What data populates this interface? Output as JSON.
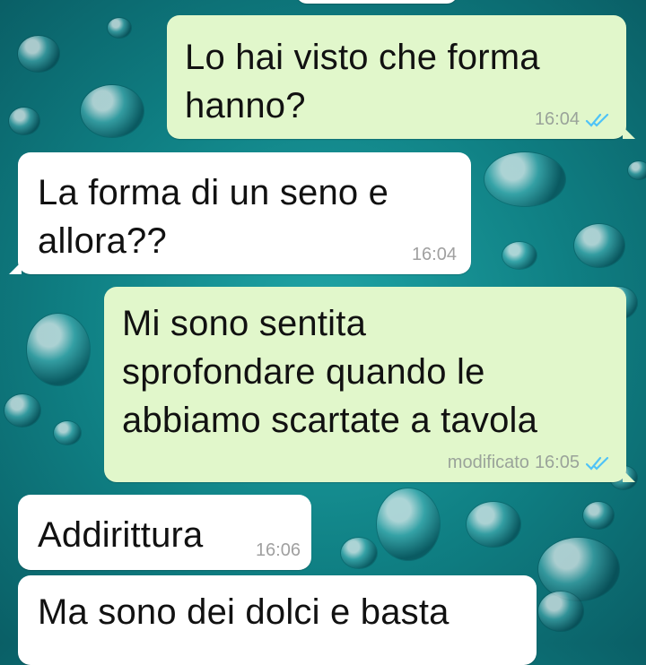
{
  "chat": {
    "messages": [
      {
        "direction": "outgoing",
        "text": "Lo hai visto che forma hanno?",
        "line1": "Lo hai visto che forma",
        "line2": "hanno?",
        "time": "16:04",
        "status": "read"
      },
      {
        "direction": "incoming",
        "text": "La forma di un seno e allora??",
        "line1": "La forma di un seno e",
        "line2": "allora??",
        "time": "16:04"
      },
      {
        "direction": "outgoing",
        "text": "Mi sono sentita sprofondare quando le abbiamo scartate a tavola",
        "line1": "Mi sono sentita",
        "line2": "sprofondare quando le",
        "line3": "abbiamo scartate a tavola",
        "meta_label": "modificato",
        "time": "16:05",
        "status": "read"
      },
      {
        "direction": "incoming",
        "text": "Addirittura",
        "time": "16:06"
      },
      {
        "direction": "incoming",
        "text": "Ma sono dei dolci e basta",
        "time": ""
      }
    ]
  },
  "icons": {
    "read_receipt": "double-check-icon"
  },
  "colors": {
    "outgoing_bubble": "#e1f7cb",
    "incoming_bubble": "#ffffff",
    "read_tick": "#4fc3f7",
    "wallpaper": "#0f7f83"
  }
}
